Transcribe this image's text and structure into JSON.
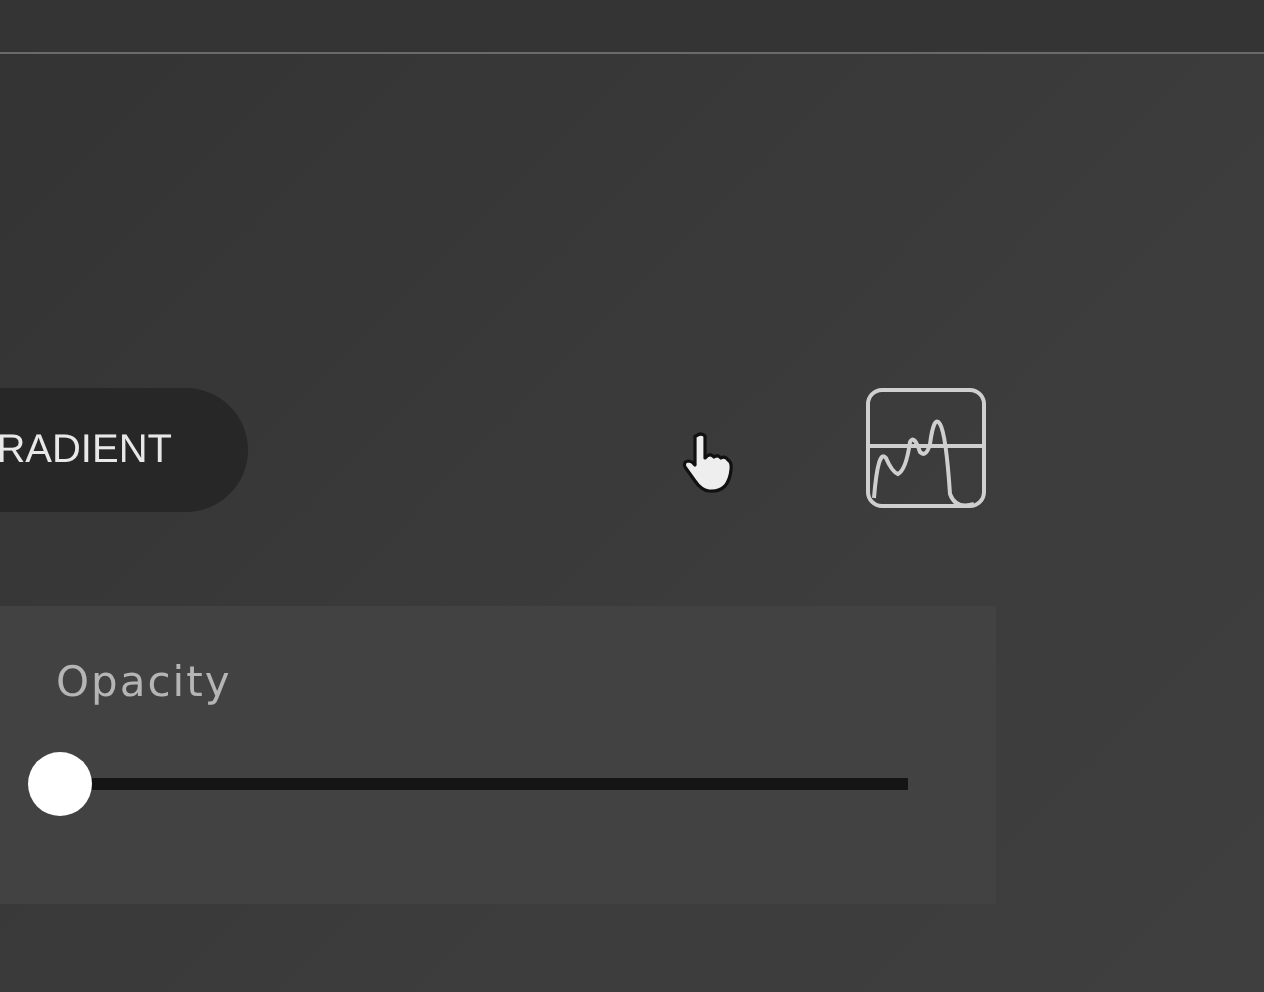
{
  "mode_button": {
    "label": "RADIENT"
  },
  "opacity": {
    "label": "Opacity",
    "level": 0
  }
}
